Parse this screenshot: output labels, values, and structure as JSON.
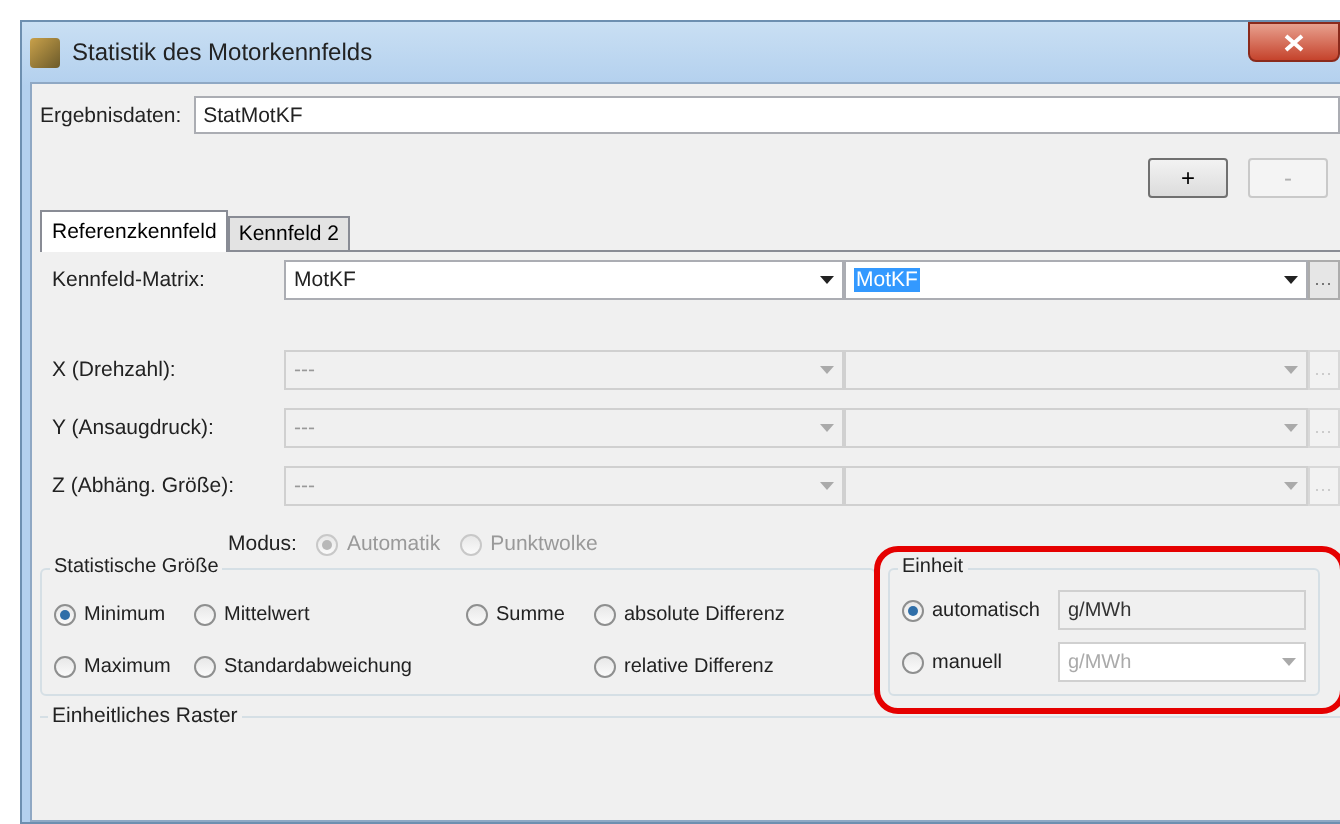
{
  "window": {
    "title": "Statistik des Motorkennfelds"
  },
  "result": {
    "label": "Ergebnisdaten:",
    "value": "StatMotKF"
  },
  "buttons": [
    {
      "label": "+",
      "disabled": false
    },
    {
      "label": "-",
      "disabled": true
    }
  ],
  "tabs": [
    {
      "label": "Referenzkennfeld",
      "selected": true
    },
    {
      "label": "Kennfeld 2",
      "selected": false
    }
  ],
  "matrix_rows": [
    {
      "label": "Kennfeld-Matrix:",
      "value": "MotKF",
      "value2": "MotKF",
      "value2_selected": true,
      "disabled": false
    },
    {
      "label": "X (Drehzahl):",
      "value": "---",
      "disabled": true
    },
    {
      "label": "Y (Ansaugdruck):",
      "value": "---",
      "disabled": true
    },
    {
      "label": "Z (Abhäng. Größe):",
      "value": "---",
      "disabled": true
    }
  ],
  "modus": {
    "label": "Modus:",
    "options": [
      {
        "label": "Automatik",
        "selected": true
      },
      {
        "label": "Punktwolke",
        "selected": false
      }
    ]
  },
  "statistic_group": {
    "title": "Statistische Größe",
    "options": [
      {
        "label": "Minimum",
        "selected": true
      },
      {
        "label": "Mittelwert",
        "selected": false
      },
      {
        "label": "Summe",
        "selected": false
      },
      {
        "label": "absolute Differenz",
        "selected": false
      },
      {
        "label": "Maximum",
        "selected": false
      },
      {
        "label": "Standardabweichung",
        "selected": false
      },
      {
        "label": "relative Differenz",
        "selected": false
      }
    ]
  },
  "unit_group": {
    "title": "Einheit",
    "options": [
      {
        "label": "automatisch",
        "selected": true,
        "value": "g/MWh",
        "kind": "text"
      },
      {
        "label": "manuell",
        "selected": false,
        "value": "g/MWh",
        "kind": "combo"
      }
    ]
  },
  "raster_group": {
    "title": "Einheitliches Raster"
  }
}
